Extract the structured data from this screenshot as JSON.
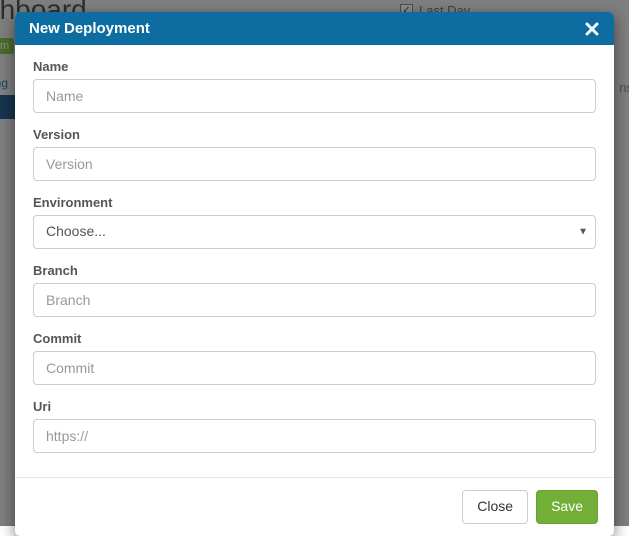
{
  "background": {
    "page_title_fragment": "ashboard",
    "checkbox_label": "Last Day",
    "right_fragment": "ns",
    "badge_fragment": "m",
    "link_fragment": "ing"
  },
  "modal": {
    "title": "New Deployment",
    "fields": {
      "name": {
        "label": "Name",
        "placeholder": "Name"
      },
      "version": {
        "label": "Version",
        "placeholder": "Version"
      },
      "environment": {
        "label": "Environment",
        "selected": "Choose..."
      },
      "branch": {
        "label": "Branch",
        "placeholder": "Branch"
      },
      "commit": {
        "label": "Commit",
        "placeholder": "Commit"
      },
      "uri": {
        "label": "Uri",
        "placeholder": "https://"
      }
    },
    "buttons": {
      "close": "Close",
      "save": "Save"
    }
  }
}
